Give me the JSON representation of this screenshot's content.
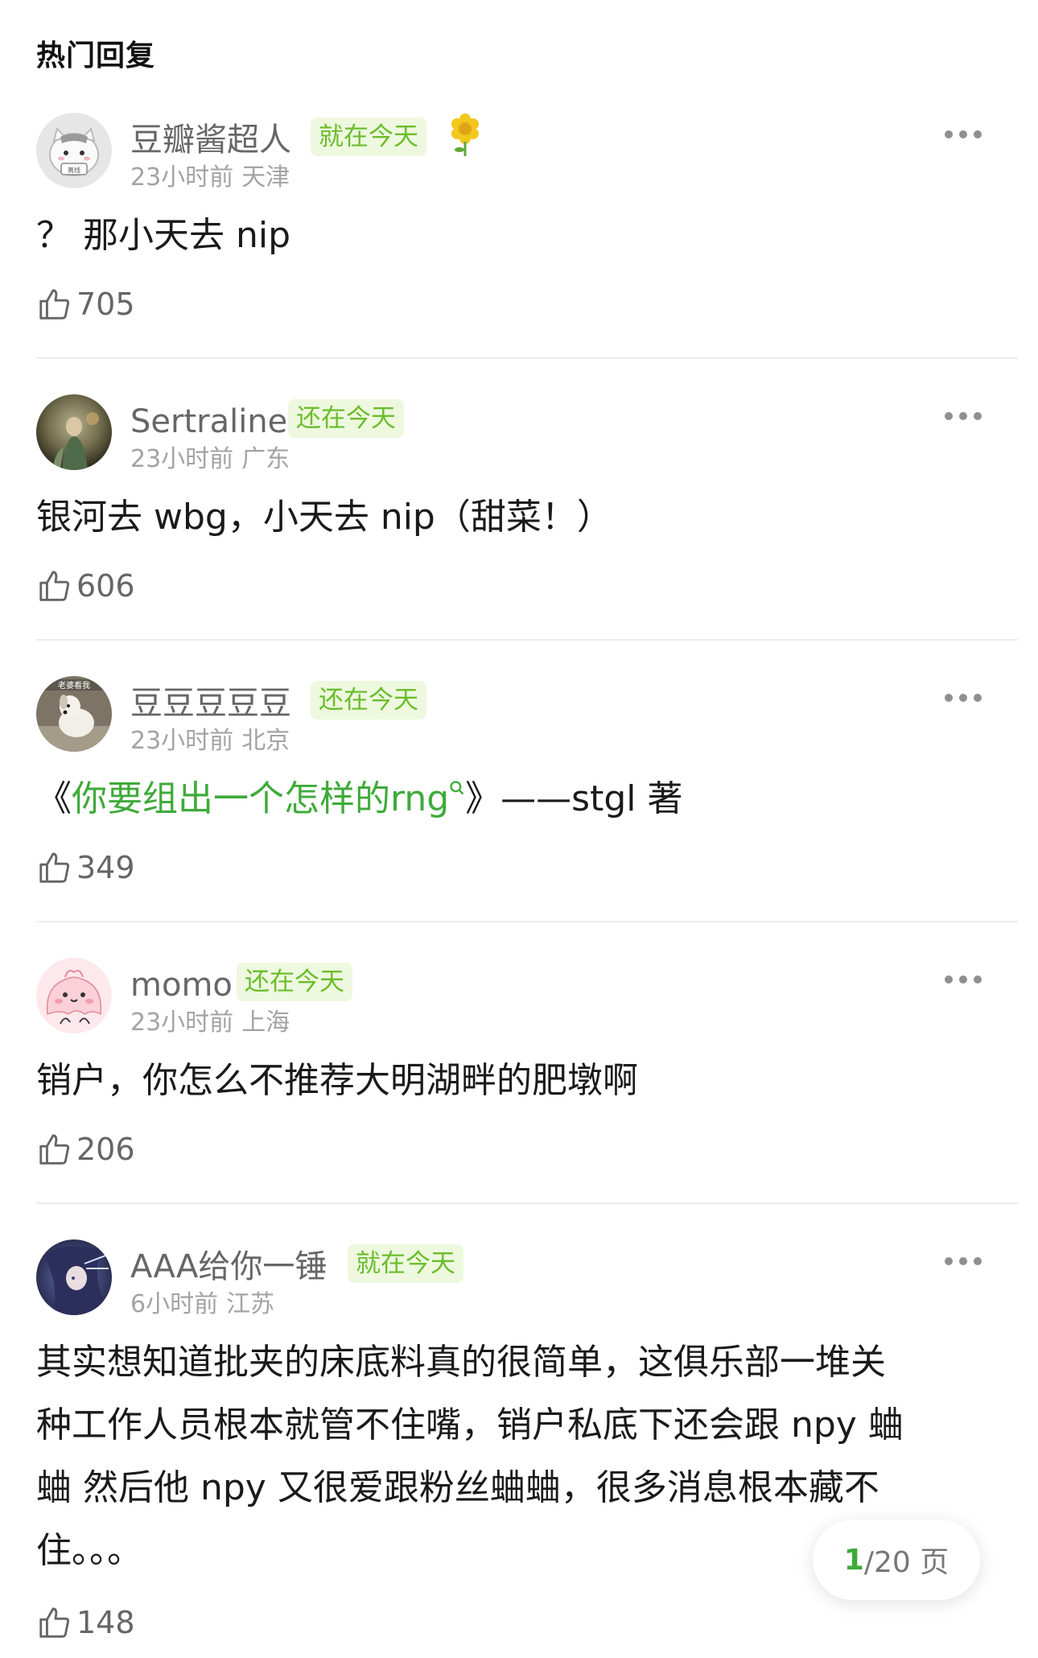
{
  "section_title": "热门回复",
  "comments": [
    {
      "username": "豆瓣酱超人",
      "badge": "就在今天",
      "time": "23小时前",
      "location": "天津",
      "text": "？ 那小天去 nip",
      "likes": "705",
      "avatar_icon": "cat-avatar-icon",
      "avatar_label": "离线"
    },
    {
      "username": "Sertraline",
      "badge": "还在今天",
      "time": "23小时前",
      "location": "广东",
      "text": "银河去 wbg，小天去 nip（甜菜！）",
      "likes": "606",
      "avatar_icon": "painting-avatar-icon"
    },
    {
      "username": "豆豆豆豆豆",
      "badge": "还在今天",
      "time": "23小时前",
      "location": "北京",
      "text_prefix": "《",
      "text_link": "你要组出一个怎样的rng",
      "text_suffix": "》——stgl 著",
      "likes": "349",
      "avatar_icon": "dog-avatar-icon",
      "avatar_label": "老婆看我"
    },
    {
      "username": "momo",
      "badge": "还在今天",
      "time": "23小时前",
      "location": "上海",
      "text": "销户，你怎么不推荐大明湖畔的肥墩啊",
      "likes": "206",
      "avatar_icon": "pink-blob-avatar-icon"
    },
    {
      "username": "AAA给你一锤",
      "badge": "就在今天",
      "time": "6小时前",
      "location": "江苏",
      "text_lines": [
        "其实想知道批夹的床底料真的很简单，这俱乐部一堆关",
        "种工作人员根本就管不住嘴，销户私底下还会跟 npy 蛐",
        "蛐 然后他 npy 又很爱跟粉丝蛐蛐，很多消息根本藏不",
        "住。。。"
      ],
      "likes": "148",
      "avatar_icon": "anime-avatar-icon"
    }
  ],
  "pager": {
    "current": "1",
    "total_text": "/20 页"
  },
  "colors": {
    "accent_green": "#3faa3a",
    "badge_bg": "#eef8df",
    "badge_text": "#6bbd2c",
    "meta_gray": "#a3a3a3"
  }
}
